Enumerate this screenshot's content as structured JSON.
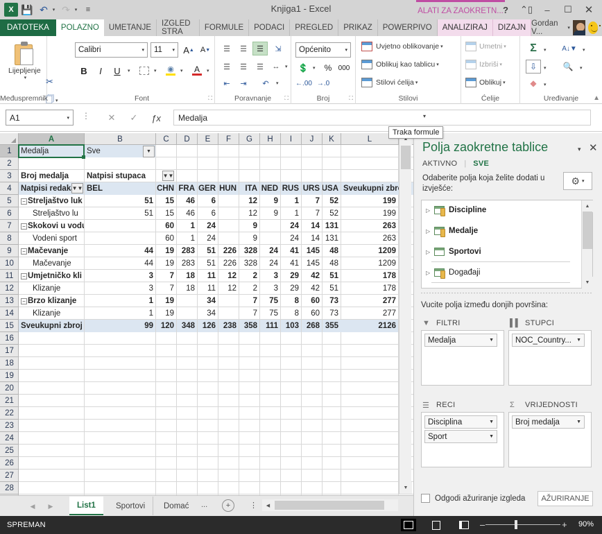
{
  "titlebar": {
    "doc_title": "Knjiga1 - Excel",
    "contextual_tab_group": "ALATI ZA ZAOKRETN...",
    "help_label": "?",
    "restore_down_label": "❐",
    "minimize_label": "–",
    "maximize_label": "☐",
    "close_label": "✕",
    "qat": [
      {
        "name": "save",
        "glyph": "💾"
      },
      {
        "name": "undo",
        "glyph": "↶"
      },
      {
        "name": "redo",
        "glyph": "↷"
      },
      {
        "name": "customize",
        "glyph": "═"
      }
    ]
  },
  "tabs": [
    {
      "label": "DATOTEKA",
      "state": "file"
    },
    {
      "label": "POLAZNO",
      "state": "active"
    },
    {
      "label": "UMETANJE",
      "state": "normal"
    },
    {
      "label": "IZGLED STRA",
      "state": "normal"
    },
    {
      "label": "FORMULE",
      "state": "normal"
    },
    {
      "label": "PODACI",
      "state": "normal"
    },
    {
      "label": "PREGLED",
      "state": "normal"
    },
    {
      "label": "PRIKAZ",
      "state": "normal"
    },
    {
      "label": "POWERPIVO",
      "state": "normal"
    },
    {
      "label": "ANALIZIRAJ",
      "state": "ctx"
    },
    {
      "label": "DIZAJN",
      "state": "ctx"
    }
  ],
  "user": {
    "name": "Gordan V...",
    "caret": "▾"
  },
  "ribbon": {
    "groups": [
      {
        "name": "Međuspremnik",
        "label": "Međuspremnik"
      },
      {
        "name": "Font",
        "label": "Font"
      },
      {
        "name": "Poravnanje",
        "label": "Poravnanje"
      },
      {
        "name": "Broj",
        "label": "Broj"
      },
      {
        "name": "Stilovi",
        "label": "Stilovi"
      },
      {
        "name": "Ćelije",
        "label": "Ćelije"
      },
      {
        "name": "Uređivanje",
        "label": "Uređivanje"
      }
    ],
    "paste_label": "Lijepljenje",
    "font_name": "Calibri",
    "font_size": "11",
    "number_format": "Općenito",
    "bold": "B",
    "italic": "I",
    "underline": "U",
    "percent": "%",
    "thousands": "000",
    "styles": [
      "Uvjetno oblikovanje",
      "Oblikuj kao tablicu",
      "Stilovi ćelija"
    ],
    "cells": [
      "Umetni",
      "Izbriši",
      "Oblikuj"
    ],
    "editing_icons": [
      "autosum",
      "sort-filter",
      "fill",
      "find-select",
      "clear"
    ]
  },
  "formulabar": {
    "namebox_value": "A1",
    "cancel_glyph": "✕",
    "accept_glyph": "✓",
    "fx_glyph": "ƒx",
    "formula_value": "Medalja",
    "tooltip": "Traka formule"
  },
  "grid": {
    "columns": [
      "A",
      "B",
      "C",
      "D",
      "E",
      "F",
      "G",
      "H",
      "I",
      "J",
      "K",
      "L"
    ],
    "selected_column": "A",
    "rows": [
      1,
      2,
      3,
      4,
      5,
      6,
      7,
      8,
      9,
      10,
      11,
      12,
      13,
      14,
      15,
      16,
      17,
      18,
      19,
      20,
      21,
      22,
      23,
      24,
      25,
      26,
      27,
      28
    ],
    "selected_row": 1,
    "cells": {
      "A1": "Medalja",
      "B1": "Sve",
      "A3": "Broj medalja",
      "B3": "Natpisi stupaca",
      "A4": "Natpisi redaka",
      "B4": "BEL",
      "C4": "CHN",
      "D4": "FRA",
      "E4": "GER",
      "F4": "HUN",
      "G4": "ITA",
      "H4": "NED",
      "I4": "RUS",
      "J4": "URS",
      "K4": "USA",
      "L4": "Sveukupni zbroj"
    },
    "pivot_rows": [
      {
        "row": 5,
        "label": "Streljaštvo luk",
        "level": 0,
        "collapse": true,
        "values": [
          "51",
          "15",
          "46",
          "6",
          "",
          "12",
          "9",
          "1",
          "7",
          "52"
        ],
        "total": "199"
      },
      {
        "row": 6,
        "label": "Streljaštvo lu",
        "level": 1,
        "collapse": false,
        "values": [
          "51",
          "15",
          "46",
          "6",
          "",
          "12",
          "9",
          "1",
          "7",
          "52"
        ],
        "total": "199"
      },
      {
        "row": 7,
        "label": "Skokovi u vodu",
        "level": 0,
        "collapse": true,
        "values": [
          "",
          "60",
          "1",
          "24",
          "",
          "9",
          "",
          "24",
          "14",
          "131"
        ],
        "total": "263"
      },
      {
        "row": 8,
        "label": "Vodeni sport",
        "level": 1,
        "collapse": false,
        "values": [
          "",
          "60",
          "1",
          "24",
          "",
          "9",
          "",
          "24",
          "14",
          "131"
        ],
        "total": "263"
      },
      {
        "row": 9,
        "label": "Mačevanje",
        "level": 0,
        "collapse": true,
        "values": [
          "44",
          "19",
          "283",
          "51",
          "226",
          "328",
          "24",
          "41",
          "145",
          "48"
        ],
        "total": "1209"
      },
      {
        "row": 10,
        "label": "Mačevanje",
        "level": 1,
        "collapse": false,
        "values": [
          "44",
          "19",
          "283",
          "51",
          "226",
          "328",
          "24",
          "41",
          "145",
          "48"
        ],
        "total": "1209"
      },
      {
        "row": 11,
        "label": "Umjetničko kli",
        "level": 0,
        "collapse": true,
        "values": [
          "3",
          "7",
          "18",
          "11",
          "12",
          "2",
          "3",
          "29",
          "42",
          "51"
        ],
        "total": "178"
      },
      {
        "row": 12,
        "label": "Klizanje",
        "level": 1,
        "collapse": false,
        "values": [
          "3",
          "7",
          "18",
          "11",
          "12",
          "2",
          "3",
          "29",
          "42",
          "51"
        ],
        "total": "178"
      },
      {
        "row": 13,
        "label": "Brzo klizanje",
        "level": 0,
        "collapse": true,
        "values": [
          "1",
          "19",
          "",
          "34",
          "",
          "7",
          "75",
          "8",
          "60",
          "73"
        ],
        "total": "277"
      },
      {
        "row": 14,
        "label": "Klizanje",
        "level": 1,
        "collapse": false,
        "values": [
          "1",
          "19",
          "",
          "34",
          "",
          "7",
          "75",
          "8",
          "60",
          "73"
        ],
        "total": "277"
      },
      {
        "row": 15,
        "label": "Sveukupni zbroj",
        "level": -1,
        "collapse": false,
        "values": [
          "99",
          "120",
          "348",
          "126",
          "238",
          "358",
          "111",
          "103",
          "268",
          "355"
        ],
        "total": "2126"
      }
    ]
  },
  "sheettabs": {
    "prev_glyph": "◀",
    "next_glyph": "▶",
    "tabs": [
      {
        "label": "List1",
        "active": true
      },
      {
        "label": "Sportovi",
        "active": false
      },
      {
        "label": "Domać",
        "active": false
      }
    ],
    "overflow": "...",
    "add_glyph": "+",
    "menu_glyph": "⋮"
  },
  "statusbar": {
    "status": "SPREMAN",
    "views": [
      "normal-view",
      "page-layout-view",
      "page-break-view"
    ],
    "zoom_minus": "–",
    "zoom_plus": "+",
    "zoom_level": "90%"
  },
  "pane": {
    "title": "Polja zaokretne tablice",
    "caret": "▾",
    "close": "✕",
    "subtabs": [
      {
        "label": "AKTIVNO",
        "active": false
      },
      {
        "label": "SVE",
        "active": true
      }
    ],
    "description": "Odaberite polja koja želite dodati u izvješće:",
    "gear_glyph": "⚙",
    "gear_caret": "▾",
    "fields": [
      {
        "label": "Discipline",
        "bold": true,
        "type": "table-cube"
      },
      {
        "label": "Medalje",
        "bold": true,
        "type": "table-cube"
      },
      {
        "label": "Sportovi",
        "bold": true,
        "type": "table-plain"
      },
      {
        "label": "Događaji",
        "bold": false,
        "type": "table-cube"
      }
    ],
    "drag_label": "Vucite polja između donjih površina:",
    "zones": [
      {
        "name": "filters",
        "header": "FILTRI",
        "icon": "filter-icon",
        "items": [
          "Medalja"
        ]
      },
      {
        "name": "columns",
        "header": "STUPCI",
        "icon": "columns-icon",
        "items": [
          "NOC_Country..."
        ]
      },
      {
        "name": "rows",
        "header": "RECI",
        "icon": "rows-icon",
        "items": [
          "Disciplina",
          "Sport"
        ]
      },
      {
        "name": "values",
        "header": "VRIJEDNOSTI",
        "icon": "sigma-icon",
        "items": [
          "Broj medalja"
        ]
      }
    ],
    "defer_label": "Odgodi ažuriranje izgleda",
    "update_button": "AŽURIRANJE"
  },
  "colors": {
    "excel_green": "#217346",
    "contextual_pink": "#bf4da3",
    "pivot_header_blue": "#dce6f1",
    "statusbar_dark": "#2b2b2b"
  }
}
